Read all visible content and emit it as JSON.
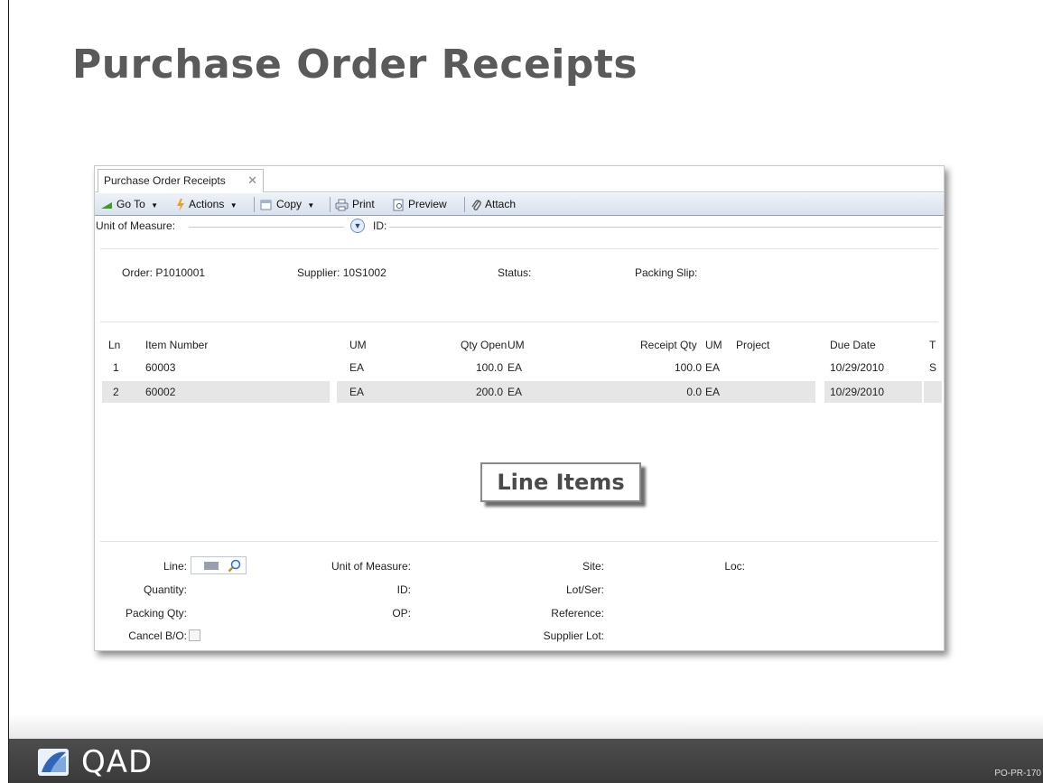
{
  "slide": {
    "title": "Purchase Order Receipts",
    "code": "PO-PR-170",
    "logo": "QAD"
  },
  "window": {
    "tab_label": "Purchase Order Receipts",
    "toolbar": {
      "goto": "Go To",
      "actions": "Actions",
      "copy": "Copy",
      "print": "Print",
      "preview": "Preview",
      "attach": "Attach"
    },
    "filter": {
      "uom_label": "Unit of Measure:",
      "id_label": "ID:"
    },
    "header": {
      "order": "Order:  P1010001",
      "supplier": "Supplier:  10S1002",
      "status": "Status:",
      "packing_slip": "Packing Slip:"
    },
    "grid": {
      "columns": [
        "Ln",
        "Item Number",
        "UM",
        "Qty Open",
        "UM",
        "Receipt Qty",
        "UM",
        "Project",
        "Due Date",
        "T"
      ],
      "rows": [
        {
          "ln": "1",
          "item": "60003",
          "um": "EA",
          "qty_open": "100.0",
          "um2": "EA",
          "receipt_qty": "100.0",
          "um3": "EA",
          "project": "",
          "due_date": "10/29/2010",
          "t": "S"
        },
        {
          "ln": "2",
          "item": "60002",
          "um": "EA",
          "qty_open": "200.0",
          "um2": "EA",
          "receipt_qty": "0.0",
          "um3": "EA",
          "project": "",
          "due_date": "10/29/2010",
          "t": ""
        }
      ]
    },
    "callout": "Line Items",
    "detail": {
      "line": "Line:",
      "quantity": "Quantity:",
      "packing_qty": "Packing Qty:",
      "cancel_bo": "Cancel B/O:",
      "uom": "Unit of Measure:",
      "id": "ID:",
      "op": "OP:",
      "site": "Site:",
      "lot_ser": "Lot/Ser:",
      "reference": "Reference:",
      "supplier_lot": "Supplier Lot:",
      "loc": "Loc:"
    }
  },
  "colors": {
    "title": "#5a5a5a",
    "toolbar": "#d9e1ec",
    "footer": "#3a3a3a",
    "row_selected": "#e6e6e6"
  }
}
